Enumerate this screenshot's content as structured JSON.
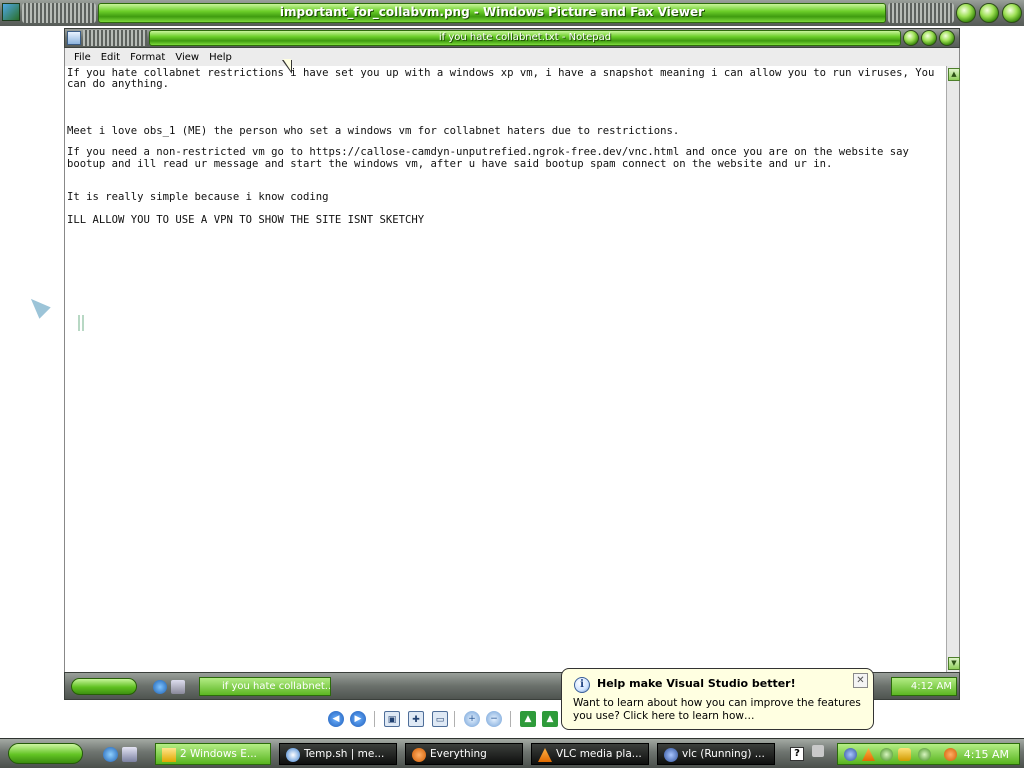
{
  "viewer": {
    "title": "important_for_collabvm.png - Windows Picture and Fax Viewer"
  },
  "notepad": {
    "title": "if you hate collabnet.txt - Notepad",
    "menu": [
      "File",
      "Edit",
      "Format",
      "View",
      "Help"
    ],
    "lines": [
      "If you hate collabnet restrictions i have set you up with a windows xp vm, i have a snapshot meaning i can allow you to run viruses, You can do anything.",
      "",
      "",
      "",
      "Meet i love obs_1 (ME) the person who set a windows vm for collabnet haters due to restrictions.",
      "",
      "If you need a non-restricted vm go to https://callose-camdyn-unputrefied.ngrok-free.dev/vnc.html and once you are on the website say bootup and ill read ur message and start the windows vm, after u have said bootup spam connect on the website and ur in.",
      "",
      "",
      "It is really simple because i know coding",
      "",
      "ILL ALLOW YOU TO USE A VPN TO SHOW THE SITE ISNT SKETCHY"
    ],
    "inner_taskbar": {
      "task_label": "if you hate collabnet...",
      "clock": "4:12 AM"
    }
  },
  "balloon": {
    "title": "Help make Visual Studio better!",
    "body": "Want to learn about how you can improve the features you use? Click here to learn how…",
    "close": "✕",
    "info": "i"
  },
  "taskbar": {
    "tasks": [
      {
        "label": "2 Windows E...",
        "active": true
      },
      {
        "label": "Temp.sh | me...",
        "active": false
      },
      {
        "label": "Everything",
        "active": false
      },
      {
        "label": "VLC media pla...",
        "active": false
      },
      {
        "label": "vlc (Running) ...",
        "active": false
      }
    ],
    "help": "?",
    "clock": "4:15 AM"
  }
}
